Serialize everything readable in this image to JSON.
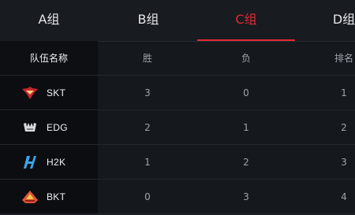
{
  "tabs": [
    {
      "label": "A组",
      "active": false
    },
    {
      "label": "B组",
      "active": false
    },
    {
      "label": "C组",
      "active": true
    },
    {
      "label": "D组",
      "active": false
    }
  ],
  "table": {
    "headers": {
      "team": "队伍名称",
      "win": "胜",
      "loss": "负",
      "rank": "排名"
    },
    "rows": [
      {
        "team": "SKT",
        "logo": "skt-logo",
        "win": "3",
        "loss": "0",
        "rank": "1"
      },
      {
        "team": "EDG",
        "logo": "edg-logo",
        "win": "2",
        "loss": "1",
        "rank": "2"
      },
      {
        "team": "H2K",
        "logo": "h2k-logo",
        "win": "1",
        "loss": "2",
        "rank": "3"
      },
      {
        "team": "BKT",
        "logo": "bkt-logo",
        "win": "0",
        "loss": "3",
        "rank": "4"
      }
    ]
  },
  "colors": {
    "accent": "#e22a35",
    "background": "#15181d",
    "team_column": "#0b0d11"
  }
}
